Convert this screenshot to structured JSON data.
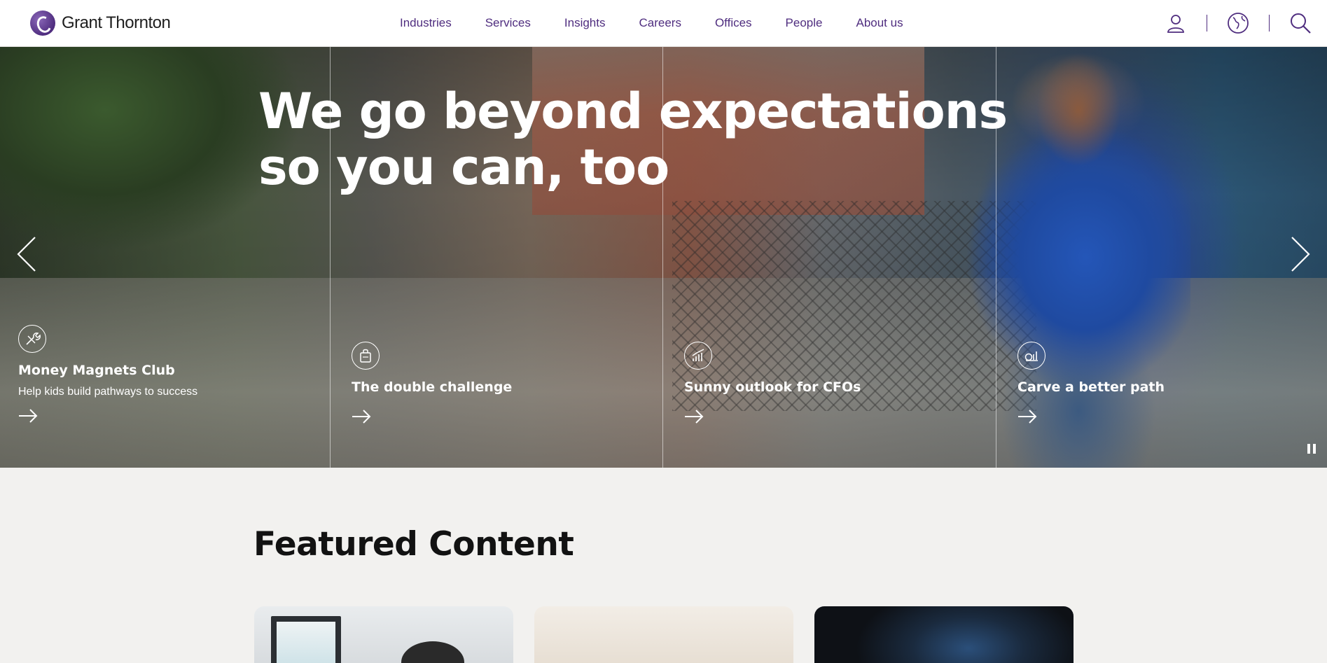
{
  "header": {
    "logo_text": "Grant Thornton",
    "nav": [
      "Industries",
      "Services",
      "Insights",
      "Careers",
      "Offices",
      "People",
      "About us"
    ],
    "icons": [
      "user-icon",
      "globe-icon",
      "search-icon"
    ]
  },
  "hero": {
    "headline_line1": "We go beyond expectations",
    "headline_line2": "so you can, too",
    "cards": [
      {
        "title": "Money Magnets Club",
        "subtitle": "Help kids build pathways to success",
        "icon": "wrench-icon"
      },
      {
        "title": "The double challenge",
        "icon": "shopping-bag-icon"
      },
      {
        "title": "Sunny outlook for CFOs",
        "icon": "growth-chart-icon"
      },
      {
        "title": "Carve a better path",
        "icon": "money-chart-icon"
      }
    ]
  },
  "featured": {
    "title": "Featured Content"
  },
  "colors": {
    "brand_purple": "#4f2d7f",
    "page_bg": "#f2f1ef"
  }
}
